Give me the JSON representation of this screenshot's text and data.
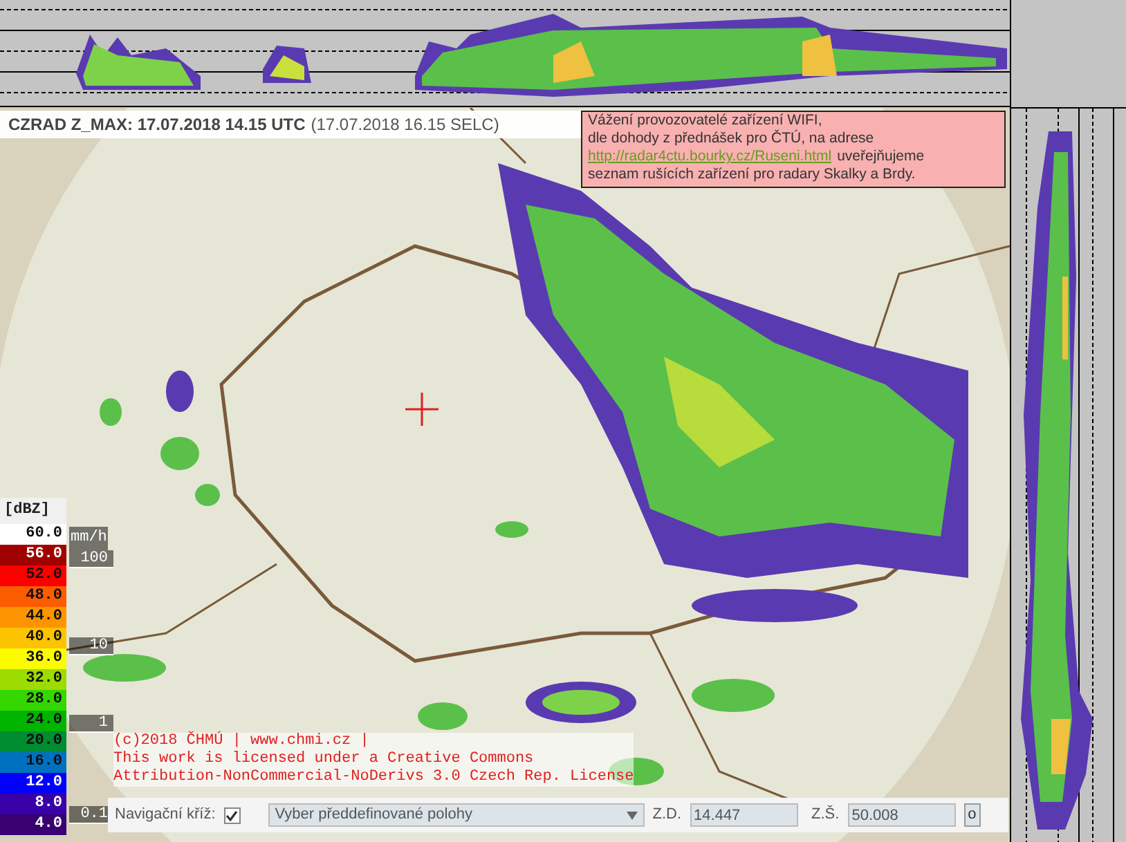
{
  "title": {
    "product": "CZRAD Z_MAX: 17.07.2018 14.15 UTC",
    "local": "(17.07.2018 16.15 SELC)"
  },
  "notice": {
    "lines": [
      "Vážení provozovatelé zařízení WIFI,",
      "dle dohody z přednášek pro ČTÚ, na adrese"
    ],
    "link": "http://radar4ctu.bourky.cz/Ruseni.html",
    "link_tail": "uveřejňujeme",
    "last_line": "seznam rušících zařízení pro radary Skalky a Brdy."
  },
  "legend": {
    "unit": "[dBZ]",
    "rain_unit": "mm/h",
    "items": [
      {
        "label": "60.0",
        "color": "#ffffff"
      },
      {
        "label": "56.0",
        "color": "#a00000"
      },
      {
        "label": "52.0",
        "color": "#fc0000"
      },
      {
        "label": "48.0",
        "color": "#fc5c00"
      },
      {
        "label": "44.0",
        "color": "#fc9400"
      },
      {
        "label": "40.0",
        "color": "#fcc400"
      },
      {
        "label": "36.0",
        "color": "#fcfc00"
      },
      {
        "label": "32.0",
        "color": "#9cdc00"
      },
      {
        "label": "28.0",
        "color": "#34d800"
      },
      {
        "label": "24.0",
        "color": "#00b400"
      },
      {
        "label": "20.0",
        "color": "#008c30"
      },
      {
        "label": "16.0",
        "color": "#0070c0"
      },
      {
        "label": "12.0",
        "color": "#0000fc"
      },
      {
        "label": "8.0",
        "color": "#3800a8"
      },
      {
        "label": "4.0",
        "color": "#380070"
      }
    ],
    "rain_marks": [
      "100",
      "10",
      "1",
      "0.1"
    ]
  },
  "copyright": [
    "(c)2018 ČHMÚ | www.chmi.cz |",
    "This work is licensed under a Creative Commons",
    "Attribution-NonCommercial-NoDerivs 3.0 Czech Rep. License"
  ],
  "controls": {
    "cross_label": "Navigační kříž:",
    "cross_checked": true,
    "preset": "Vyber předdefinované polohy",
    "lon_label": "Z.D.",
    "lon": "14.447",
    "lat_label": "Z.Š.",
    "lat": "50.008",
    "go": "o"
  }
}
